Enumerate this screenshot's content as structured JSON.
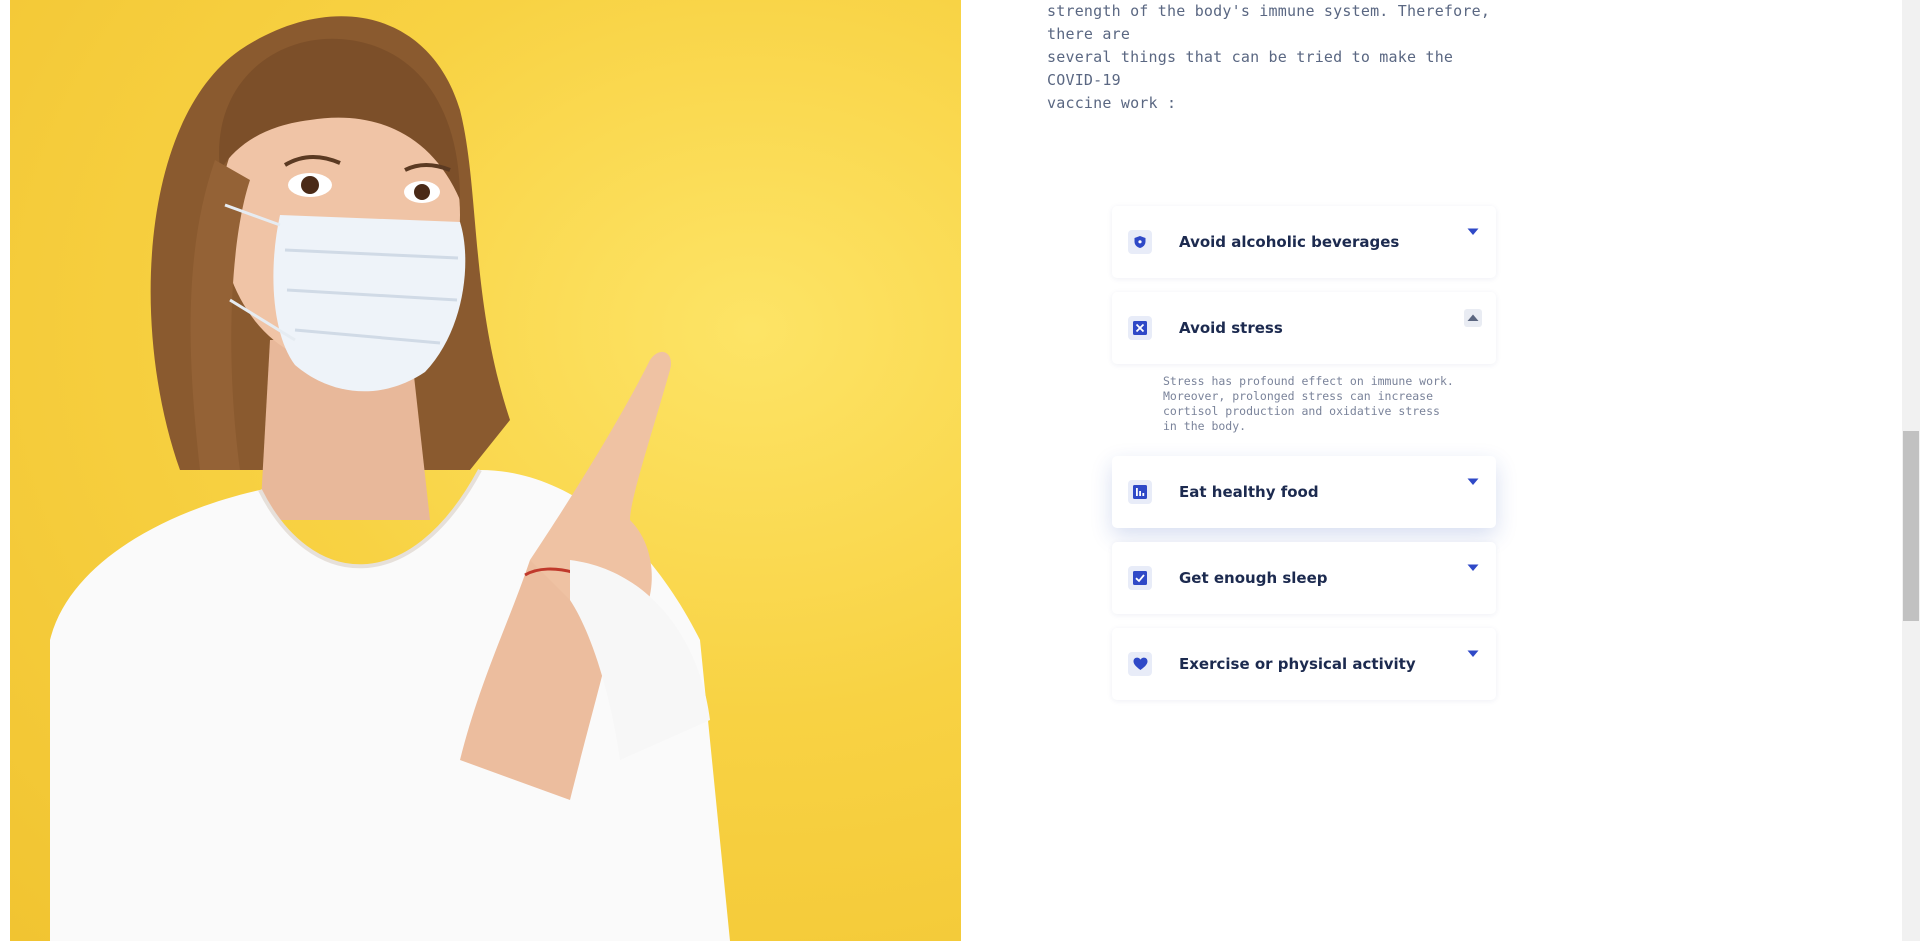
{
  "hero": {
    "image_alt": "Woman wearing a face mask pointing up"
  },
  "intro": {
    "lines": [
      "strength of the body's immune system. Therefore, there are",
      "several things that can be tried to make the COVID-19",
      "vaccine work :"
    ]
  },
  "accordion": {
    "items": [
      {
        "title": "Avoid alcoholic beverages",
        "icon": "shield-icon",
        "expanded": false
      },
      {
        "title": "Avoid stress",
        "icon": "x-square-icon",
        "expanded": true,
        "body": "Stress has profound effect on immune work. Moreover, prolonged stress can increase cortisol production and oxidative stress in the body."
      },
      {
        "title": "Eat healthy food",
        "icon": "bar-chart-icon",
        "expanded": false,
        "highlighted": true
      },
      {
        "title": "Get enough sleep",
        "icon": "checkbox-icon",
        "expanded": false
      },
      {
        "title": "Exercise or physical activity",
        "icon": "heart-icon",
        "expanded": false
      }
    ]
  },
  "colors": {
    "accent": "#2f49c7",
    "heading": "#1c2a4f",
    "body_text": "#5a6782",
    "hero_background": "#f8d243"
  }
}
